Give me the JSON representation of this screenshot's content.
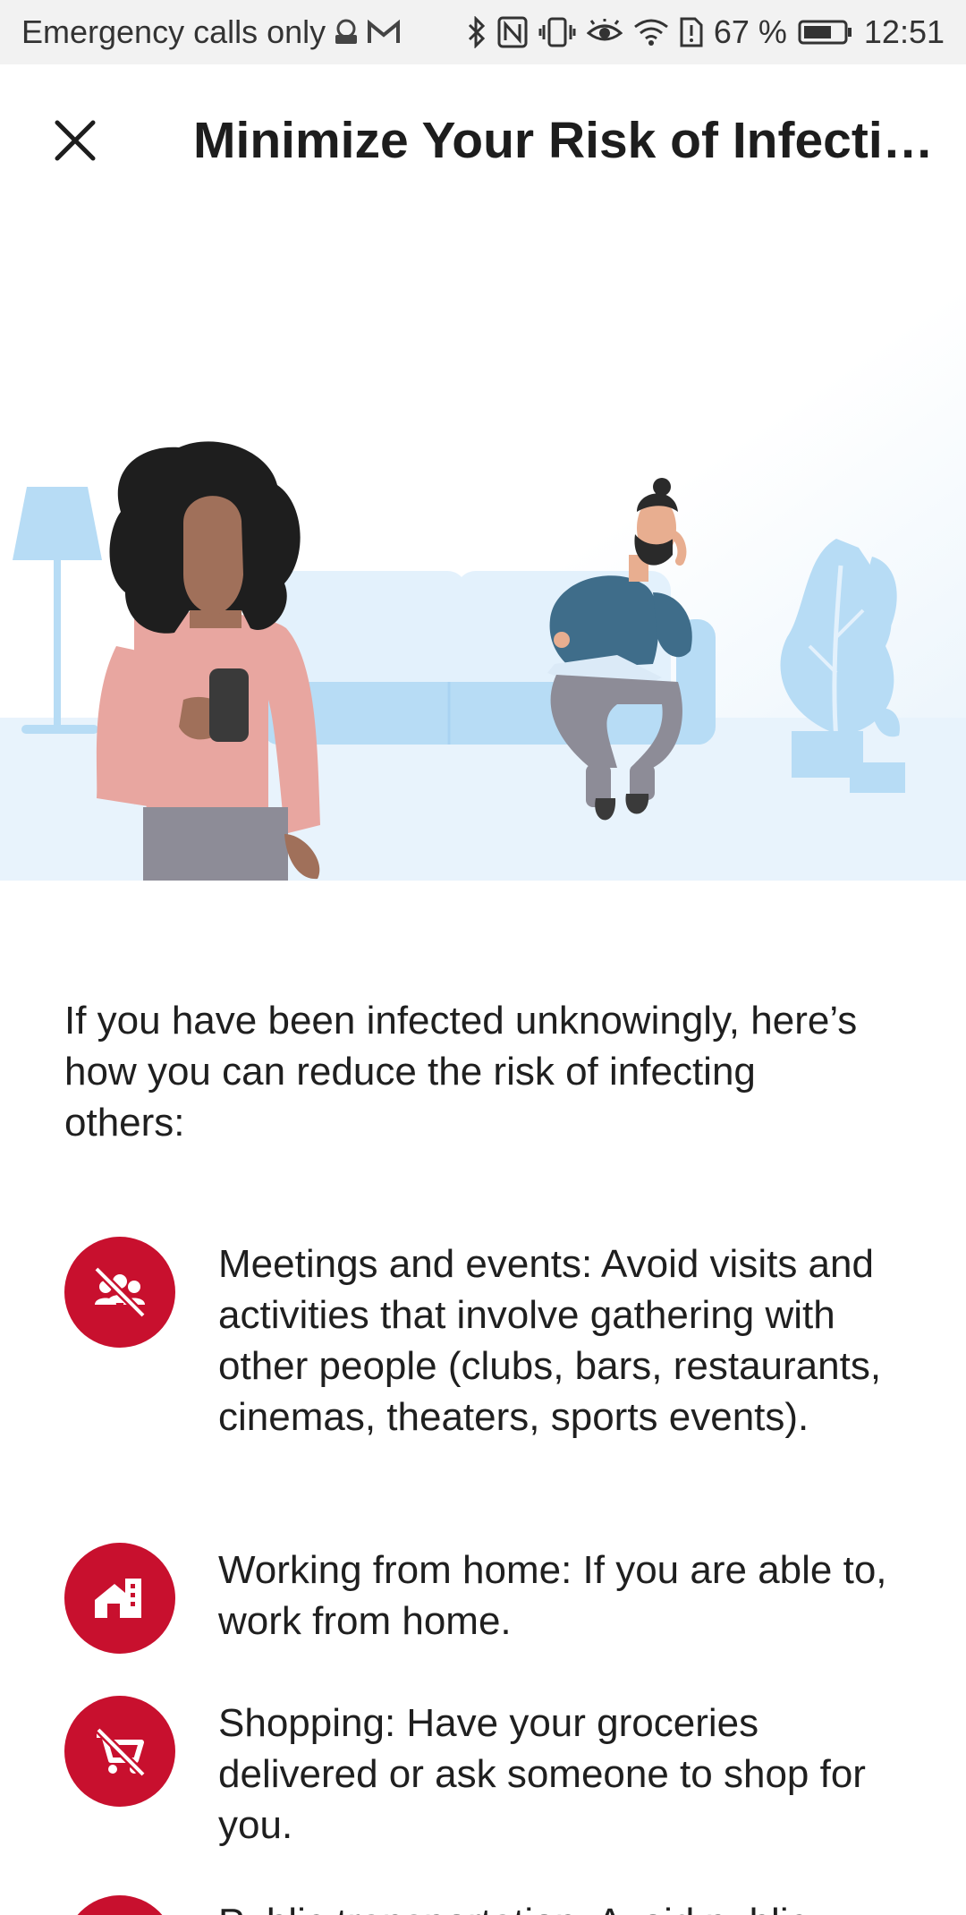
{
  "status_bar": {
    "carrier": "Emergency calls only",
    "battery": "67 %",
    "time": "12:51",
    "icons": [
      "vpn-icon",
      "gmail-icon",
      "bluetooth-icon",
      "nfc-icon",
      "vibrate-icon",
      "eye-comfort-icon",
      "wifi-icon",
      "sim-alert-icon",
      "battery-icon"
    ]
  },
  "header": {
    "title": "Minimize Your Risk of Infecti…",
    "close_icon": "close-icon"
  },
  "hero": {
    "illustration": "living-room-illustration"
  },
  "intro": {
    "text": "If you have been infected unknowingly, here’s how you can reduce the risk of infecting others:"
  },
  "tips": [
    {
      "icon": "no-gathering-icon",
      "text": "Meetings and events: Avoid visits and activities that involve gathering with other people (clubs, bars, restaurants, cinemas, theaters, sports events)."
    },
    {
      "icon": "work-from-home-icon",
      "text": "Working from home: If you are able to, work from home."
    },
    {
      "icon": "no-shopping-icon",
      "text": "Shopping: Have your groceries delivered or ask someone to shop for you."
    },
    {
      "icon": "public-transport-icon",
      "text": "Public transportation: Avoid public"
    }
  ],
  "colors": {
    "accent": "#c8102e",
    "hero_background": "#e8f3fc",
    "furniture": "#b7dcf5"
  }
}
